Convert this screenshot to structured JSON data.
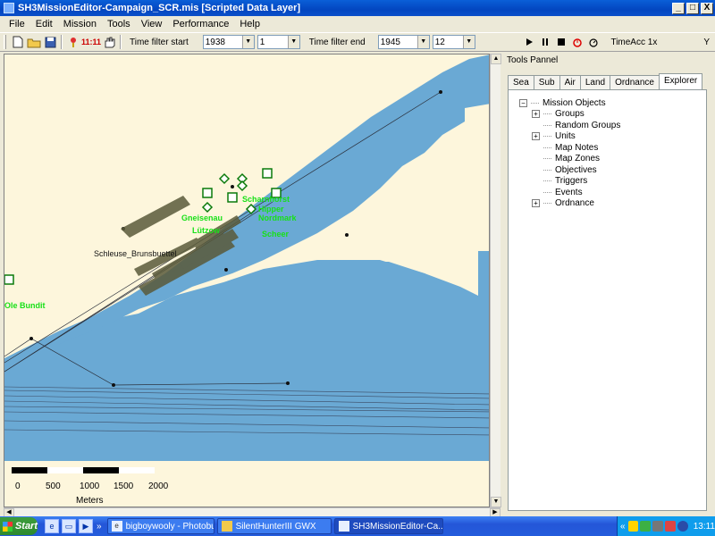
{
  "window": {
    "title": "SH3MissionEditor-Campaign_SCR.mis [Scripted Data Layer]",
    "buttons": [
      "_",
      "□",
      "X"
    ]
  },
  "menu": [
    "File",
    "Edit",
    "Mission",
    "Tools",
    "View",
    "Performance",
    "Help"
  ],
  "toolbar": {
    "clock_text": "11:11",
    "time_filter_start_label": "Time filter start",
    "start_year": "1938",
    "start_month": "1",
    "time_filter_end_label": "Time filter end",
    "end_year": "1945",
    "end_month": "12",
    "time_acc": "TimeAcc 1x",
    "right_marker": "Y"
  },
  "map": {
    "land_color": "#fdf6dc",
    "sea_color": "#6aa9d4",
    "shallow_color": "#9cc9e6",
    "label_color": "#18e018",
    "labels": {
      "lock": "Schleuse_Brunsbuettel",
      "unit_a": "Scheer",
      "unit_b": "Nordmark",
      "unit_c": "Hipper",
      "unit_d": "Scharnhorst",
      "unit_e": "Gneisenau",
      "unit_f": "Lützow",
      "left_label": "Ole Bundit"
    },
    "scale": {
      "ticks": [
        "0",
        "500",
        "1000",
        "1500",
        "2000"
      ],
      "unit": "Meters"
    }
  },
  "tools_panel": {
    "title": "Tools Pannel",
    "tabs": [
      "Sea",
      "Sub",
      "Air",
      "Land",
      "Ordnance",
      "Explorer"
    ],
    "active_tab": "Explorer",
    "tree": {
      "root": "Mission Objects",
      "children": [
        {
          "label": "Groups",
          "expandable": true
        },
        {
          "label": "Random Groups",
          "expandable": false
        },
        {
          "label": "Units",
          "expandable": true
        },
        {
          "label": "Map Notes",
          "expandable": false
        },
        {
          "label": "Map Zones",
          "expandable": false
        },
        {
          "label": "Objectives",
          "expandable": false
        },
        {
          "label": "Triggers",
          "expandable": false
        },
        {
          "label": "Events",
          "expandable": false
        },
        {
          "label": "Ordnance",
          "expandable": true
        }
      ]
    }
  },
  "taskbar": {
    "start": "Start",
    "overflow": "»",
    "tasks": [
      {
        "label": "bigboywooly - Photobuck...",
        "active": false
      },
      {
        "label": "SilentHunterIII GWX",
        "active": false
      },
      {
        "label": "SH3MissionEditor-Ca...",
        "active": true
      }
    ],
    "tray_chevron": "«",
    "clock": "13:11"
  }
}
